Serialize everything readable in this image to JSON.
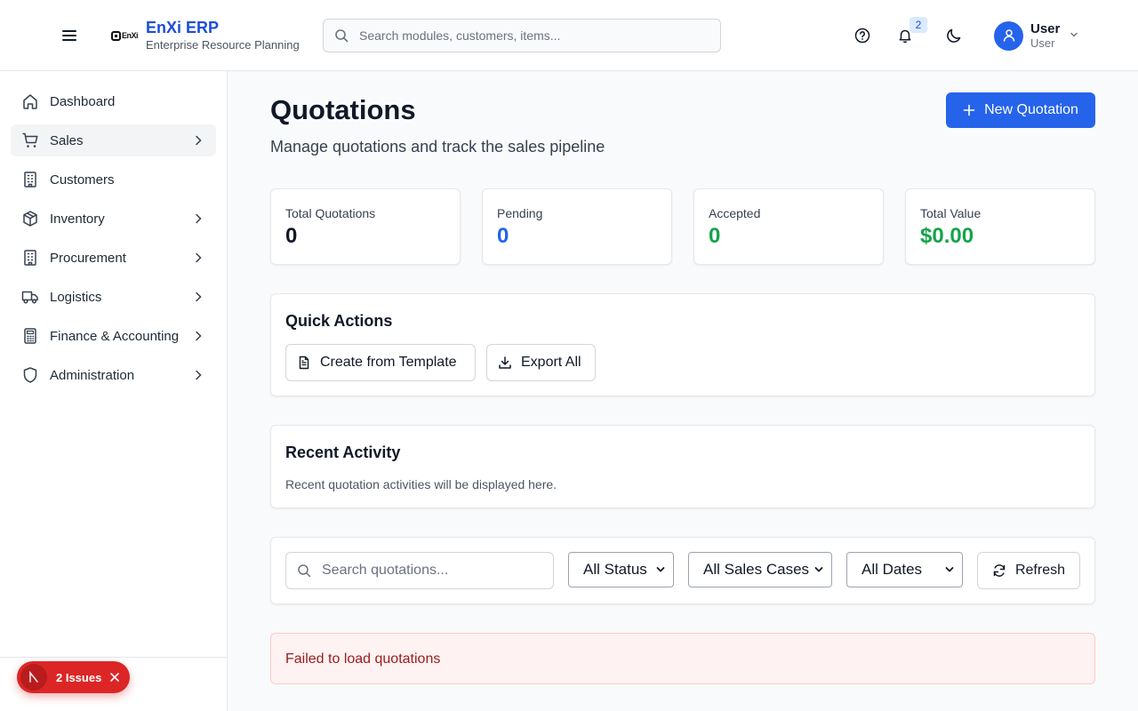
{
  "header": {
    "logo_mark_text": "EnXi",
    "brand_title": "EnXi ERP",
    "brand_subtitle": "Enterprise Resource Planning",
    "search_placeholder": "Search modules, customers, items...",
    "notification_count": "2",
    "user_name": "User",
    "user_role": "User"
  },
  "sidebar": {
    "items": [
      {
        "label": "Dashboard",
        "icon": "home-icon",
        "has_submenu": false
      },
      {
        "label": "Sales",
        "icon": "cart-icon",
        "has_submenu": true,
        "active": true
      },
      {
        "label": "Customers",
        "icon": "building-icon",
        "has_submenu": false
      },
      {
        "label": "Inventory",
        "icon": "package-icon",
        "has_submenu": true
      },
      {
        "label": "Procurement",
        "icon": "building-icon",
        "has_submenu": true
      },
      {
        "label": "Logistics",
        "icon": "truck-icon",
        "has_submenu": true
      },
      {
        "label": "Finance & Accounting",
        "icon": "calculator-icon",
        "has_submenu": true
      },
      {
        "label": "Administration",
        "icon": "shield-icon",
        "has_submenu": true
      }
    ],
    "issues_label": "2 Issues"
  },
  "main": {
    "title": "Quotations",
    "subtitle": "Manage quotations and track the sales pipeline",
    "new_button": "New Quotation",
    "stats": [
      {
        "label": "Total Quotations",
        "value": "0",
        "color": "#111827"
      },
      {
        "label": "Pending",
        "value": "0",
        "color": "#2563eb"
      },
      {
        "label": "Accepted",
        "value": "0",
        "color": "#16a34a"
      },
      {
        "label": "Total Value",
        "value": "$0.00",
        "color": "#16a34a"
      }
    ],
    "quick_actions": {
      "title": "Quick Actions",
      "template_button": "Create from Template",
      "export_button": "Export All"
    },
    "recent_activity": {
      "title": "Recent Activity",
      "text": "Recent quotation activities will be displayed here."
    },
    "filters": {
      "search_placeholder": "Search quotations...",
      "status": "All Status",
      "sales_cases": "All Sales Cases",
      "dates": "All Dates",
      "refresh_button": "Refresh"
    },
    "error_message": "Failed to load quotations"
  },
  "colors": {
    "accent": "#2563eb",
    "brand": "#1d4ed8",
    "success": "#16a34a",
    "error_bg": "#fef2f2",
    "error_text": "#991b1b",
    "issues_badge": "#dc2626"
  }
}
